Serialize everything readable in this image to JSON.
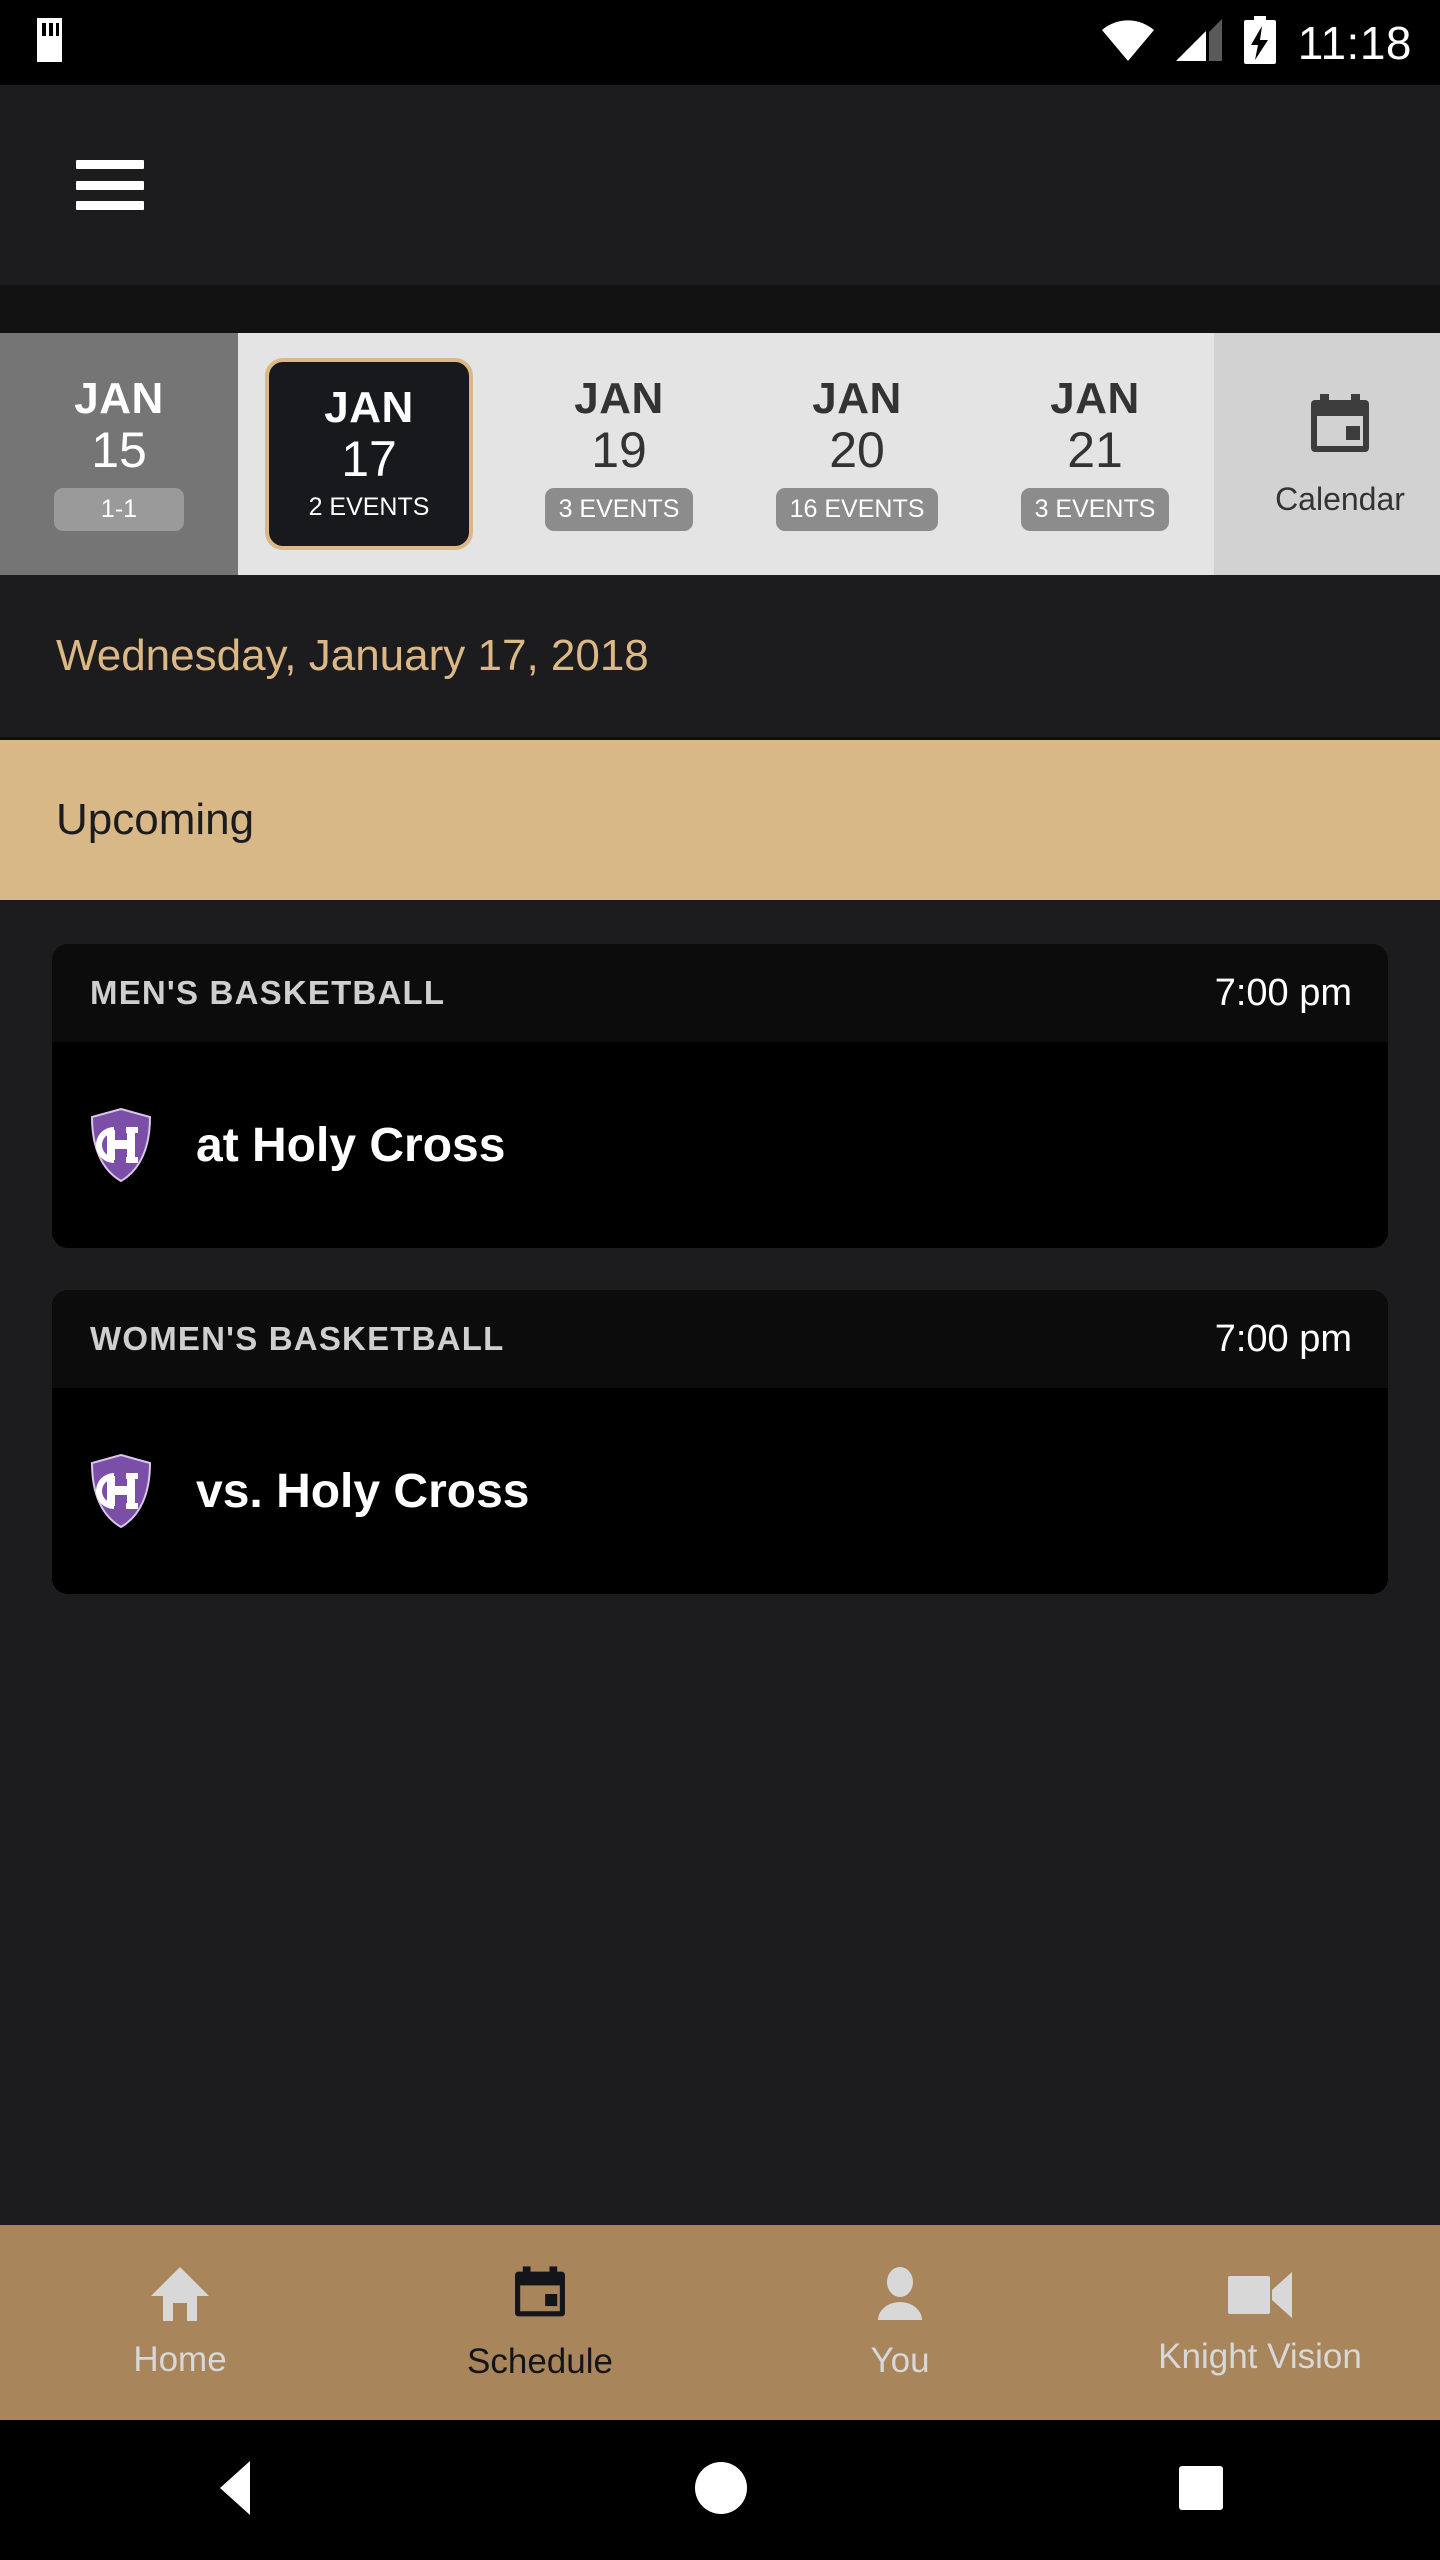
{
  "status_bar": {
    "time": "11:18",
    "icons": [
      "sd-card-icon",
      "wifi-icon",
      "cellular-signal-icon",
      "battery-charging-icon"
    ]
  },
  "app_header": {
    "menu_icon": "hamburger-menu-icon"
  },
  "date_strip": {
    "tabs": [
      {
        "month": "JAN",
        "day": "15",
        "badge": "1-1",
        "state": "past"
      },
      {
        "month": "JAN",
        "day": "17",
        "badge": "2 EVENTS",
        "state": "selected"
      },
      {
        "month": "JAN",
        "day": "19",
        "badge": "3 EVENTS",
        "state": "normal"
      },
      {
        "month": "JAN",
        "day": "20",
        "badge": "16 EVENTS",
        "state": "normal"
      },
      {
        "month": "JAN",
        "day": "21",
        "badge": "3 EVENTS",
        "state": "normal"
      }
    ],
    "calendar_tab": {
      "label": "Calendar",
      "icon": "calendar-icon"
    }
  },
  "date_heading": {
    "text": "Wednesday, January 17, 2018"
  },
  "section": {
    "upcoming_label": "Upcoming"
  },
  "events": [
    {
      "sport": "MEN'S BASKETBALL",
      "time": "7:00 pm",
      "opponent": "at Holy Cross",
      "logo": "holy-cross-shield-logo"
    },
    {
      "sport": "WOMEN'S BASKETBALL",
      "time": "7:00 pm",
      "opponent": "vs. Holy Cross",
      "logo": "holy-cross-shield-logo"
    }
  ],
  "bottom_nav": {
    "items": [
      {
        "label": "Home",
        "icon": "home-icon",
        "active": false
      },
      {
        "label": "Schedule",
        "icon": "calendar-icon",
        "active": true
      },
      {
        "label": "You",
        "icon": "person-icon",
        "active": false
      },
      {
        "label": "Knight Vision",
        "icon": "video-camera-icon",
        "active": false
      }
    ]
  },
  "system_nav": {
    "back": "back-triangle-icon",
    "home": "home-circle-icon",
    "recents": "recents-square-icon"
  },
  "colors": {
    "accent_gold": "#d9b887",
    "nav_bronze": "#a8855a",
    "page_bg": "#1c1c1e",
    "card_bg": "#000000",
    "logo_purple": "#7b4fa8"
  }
}
